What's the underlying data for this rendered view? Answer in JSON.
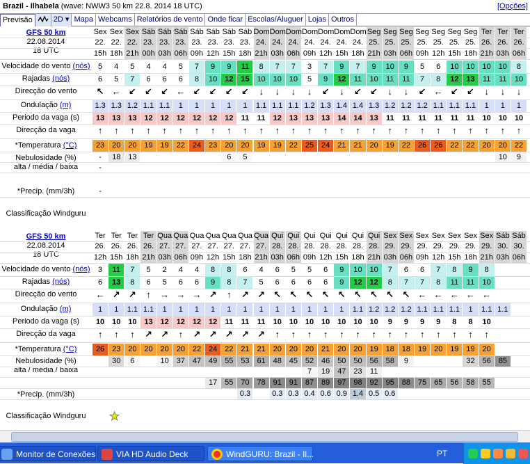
{
  "header": {
    "title": "Brazil - Ilhabela",
    "wave": "(wave: NWW3 50 km 22.8. 2014 18 UTC)",
    "options": "[Opções]"
  },
  "tabs": [
    {
      "label": "Previsão"
    },
    {
      "label": "2D"
    },
    {
      "label": "Mapa"
    },
    {
      "label": "Webcams"
    },
    {
      "label": "Relatórios de vento"
    },
    {
      "label": "Onde ficar"
    },
    {
      "label": "Escolas/Aluguer"
    },
    {
      "label": "Lojas"
    },
    {
      "label": "Outros"
    }
  ],
  "labels": {
    "wind": "Velocidade do vento",
    "wind_unit": "(nós)",
    "gust": "Rajadas",
    "gust_unit": "(nós)",
    "dir": "Direcção do vento",
    "wave": "Ondulação",
    "wave_unit": "(m)",
    "period": "Periodo da vaga (s)",
    "wdir": "Direcção da vaga",
    "temp": "*Temperatura",
    "temp_unit": "(°C)",
    "cloud1": "Nebulosidade (%)",
    "cloud2": "alta / média / baixa",
    "precip": "*Precip. (mm/3h)",
    "rating": "Classificação Windguru"
  },
  "block1": {
    "model": "GFS 50 km",
    "date": "22.08.2014",
    "utc": "18 UTC",
    "days": [
      "Sex",
      "Sex",
      "Sex",
      "Sáb",
      "Sáb",
      "Sáb",
      "Sáb",
      "Sáb",
      "Sáb",
      "Sáb",
      "Dom",
      "Dom",
      "Dom",
      "Dom",
      "Dom",
      "Dom",
      "Dom",
      "Seg",
      "Seg",
      "Seg",
      "Seg",
      "Seg",
      "Seg",
      "Seg",
      "Ter",
      "Ter",
      "Ter"
    ],
    "dates": [
      "22.",
      "22.",
      "22.",
      "23.",
      "23.",
      "23.",
      "23.",
      "23.",
      "23.",
      "23.",
      "24.",
      "24.",
      "24.",
      "24.",
      "24.",
      "24.",
      "24.",
      "25.",
      "25.",
      "25.",
      "25.",
      "25.",
      "25.",
      "25.",
      "26.",
      "26.",
      "26."
    ],
    "hours": [
      "15h",
      "18h",
      "21h",
      "00h",
      "03h",
      "06h",
      "09h",
      "12h",
      "15h",
      "18h",
      "21h",
      "03h",
      "06h",
      "09h",
      "12h",
      "15h",
      "18h",
      "21h",
      "03h",
      "06h",
      "09h",
      "12h",
      "15h",
      "18h",
      "21h",
      "03h",
      "06h"
    ],
    "wind": [
      "5",
      "4",
      "5",
      "4",
      "4",
      "5",
      "7",
      "9",
      "9",
      "11",
      "8",
      "7",
      "7",
      "3",
      "7",
      "9",
      "7",
      "9",
      "10",
      "9",
      "5",
      "6",
      "10",
      "10",
      "10",
      "10",
      "8"
    ],
    "gust": [
      "6",
      "5",
      "7",
      "6",
      "6",
      "6",
      "8",
      "10",
      "12",
      "15",
      "10",
      "10",
      "10",
      "5",
      "9",
      "12",
      "11",
      "10",
      "11",
      "11",
      "7",
      "8",
      "12",
      "13",
      "11",
      "11",
      "10"
    ],
    "dir": [
      "↖",
      "←",
      "↙",
      "↙",
      "↙",
      "←",
      "↙",
      "↙",
      "↙",
      "↙",
      "↓",
      "↓",
      "↓",
      "↓",
      "↙",
      "↓",
      "↙",
      "↙",
      "↓",
      "↓",
      "↙",
      "←",
      "↙",
      "↙",
      "↓",
      "↓",
      "↓"
    ],
    "wave": [
      "1.3",
      "1.3",
      "1.2",
      "1.1",
      "1.1",
      "1",
      "1",
      "1",
      "1",
      "1",
      "1.1",
      "1.1",
      "1.1",
      "1.2",
      "1.3",
      "1.4",
      "1.4",
      "1.3",
      "1.2",
      "1.2",
      "1.2",
      "1.1",
      "1.1",
      "1.1",
      "1",
      "1",
      "1"
    ],
    "period": [
      "13",
      "13",
      "13",
      "12",
      "12",
      "12",
      "12",
      "12",
      "12",
      "11",
      "11",
      "12",
      "13",
      "13",
      "13",
      "14",
      "14",
      "13",
      "11",
      "11",
      "11",
      "11",
      "11",
      "11",
      "10",
      "10",
      "10"
    ],
    "wdir": [
      "↑",
      "↑",
      "↑",
      "↑",
      "↑",
      "↑",
      "↑",
      "↑",
      "↑",
      "↑",
      "↑",
      "↑",
      "↑",
      "↑",
      "↑",
      "↑",
      "↑",
      "↑",
      "↑",
      "↑",
      "↑",
      "↑",
      "↑",
      "↑",
      "↑",
      "↑",
      "↑"
    ],
    "temp": [
      "23",
      "20",
      "20",
      "19",
      "19",
      "22",
      "24",
      "23",
      "20",
      "20",
      "19",
      "19",
      "22",
      "25",
      "24",
      "21",
      "21",
      "20",
      "19",
      "22",
      "26",
      "26",
      "22",
      "22",
      "20",
      "20",
      "22"
    ],
    "cloud_h": [
      "-",
      "18",
      "13",
      "",
      "",
      "",
      "",
      "",
      "6",
      "5",
      "",
      "",
      "",
      "",
      "",
      "",
      "",
      "",
      "",
      "",
      "",
      "",
      "",
      "",
      "",
      "10",
      "9"
    ],
    "cloud_m": [
      "-",
      "",
      "",
      "",
      "",
      "",
      "",
      "",
      "",
      "",
      "",
      "",
      "",
      "",
      "",
      "",
      "",
      "",
      "",
      "",
      "",
      "",
      "",
      "",
      "",
      "",
      ""
    ],
    "precip": [
      "-",
      "",
      "",
      "",
      "",
      "",
      "",
      "",
      "",
      "",
      "",
      "",
      "",
      "",
      "",
      "",
      "",
      "",
      "",
      "",
      "",
      "",
      "",
      "",
      "",
      "",
      ""
    ]
  },
  "block2": {
    "model": "GFS 50 km",
    "date": "22.08.2014",
    "utc": "18 UTC",
    "days": [
      "Ter",
      "Ter",
      "Ter",
      "Ter",
      "Qua",
      "Qua",
      "Qua",
      "Qua",
      "Qua",
      "Qua",
      "Qua",
      "Qui",
      "Qui",
      "Qui",
      "Qui",
      "Qui",
      "Qui",
      "Qui",
      "Sex",
      "Sex",
      "Sex",
      "Sex",
      "Sex",
      "Sex",
      "Sex",
      "Sáb",
      "Sáb"
    ],
    "dates": [
      "26.",
      "26.",
      "26.",
      "26.",
      "27.",
      "27.",
      "27.",
      "27.",
      "27.",
      "27.",
      "27.",
      "28.",
      "28.",
      "28.",
      "28.",
      "28.",
      "28.",
      "28.",
      "29.",
      "29.",
      "29.",
      "29.",
      "29.",
      "29.",
      "29.",
      "30.",
      "30."
    ],
    "hours": [
      "12h",
      "15h",
      "18h",
      "21h",
      "03h",
      "06h",
      "09h",
      "12h",
      "15h",
      "18h",
      "21h",
      "03h",
      "06h",
      "09h",
      "12h",
      "15h",
      "18h",
      "21h",
      "03h",
      "06h",
      "09h",
      "12h",
      "15h",
      "18h",
      "21h",
      "03h",
      "06h"
    ],
    "wind": [
      "3",
      "11",
      "7",
      "5",
      "2",
      "4",
      "4",
      "8",
      "8",
      "6",
      "4",
      "6",
      "5",
      "5",
      "6",
      "9",
      "10",
      "10",
      "7",
      "6",
      "6",
      "7",
      "8",
      "9",
      "8",
      "",
      ""
    ],
    "gust": [
      "6",
      "13",
      "8",
      "6",
      "5",
      "6",
      "6",
      "9",
      "8",
      "7",
      "5",
      "6",
      "6",
      "6",
      "6",
      "9",
      "12",
      "12",
      "8",
      "7",
      "7",
      "8",
      "11",
      "11",
      "10",
      "",
      ""
    ],
    "dir": [
      "←",
      "↗",
      "↗",
      "↑",
      "→",
      "→",
      "→",
      "↗",
      "↑",
      "↗",
      "↗",
      "↖",
      "↖",
      "↖",
      "↖",
      "↖",
      "↖",
      "↖",
      "↖",
      "↖",
      "←",
      "←",
      "←",
      "←",
      "←",
      "",
      ""
    ],
    "wave": [
      "1",
      "1",
      "1.1",
      "1.1",
      "1",
      "1",
      "1",
      "1",
      "1",
      "1",
      "1",
      "1",
      "1",
      "1",
      "1",
      "1",
      "1.1",
      "1.2",
      "1.2",
      "1.2",
      "1.1",
      "1.1",
      "1.1",
      "1",
      "1.1",
      "1.1",
      ""
    ],
    "period": [
      "10",
      "10",
      "10",
      "13",
      "12",
      "12",
      "12",
      "12",
      "11",
      "11",
      "11",
      "10",
      "10",
      "10",
      "10",
      "10",
      "10",
      "10",
      "9",
      "9",
      "9",
      "9",
      "8",
      "8",
      "10",
      "",
      ""
    ],
    "wdir": [
      "↑",
      "↑",
      "↑",
      "↗",
      "↗",
      "↑",
      "↗",
      "↗",
      "↗",
      "↗",
      "↗",
      "↑",
      "↑",
      "↑",
      "↑",
      "↑",
      "↑",
      "↑",
      "↑",
      "↑",
      "↑",
      "↑",
      "↑",
      "↑",
      "↑",
      "",
      ""
    ],
    "temp": [
      "26",
      "23",
      "20",
      "20",
      "20",
      "20",
      "22",
      "24",
      "22",
      "21",
      "21",
      "20",
      "20",
      "20",
      "21",
      "20",
      "20",
      "19",
      "18",
      "18",
      "19",
      "20",
      "19",
      "19",
      "20",
      "",
      ""
    ],
    "cloud_h": [
      "",
      "30",
      "6",
      "",
      "10",
      "37",
      "47",
      "49",
      "55",
      "53",
      "61",
      "48",
      "45",
      "52",
      "46",
      "50",
      "50",
      "56",
      "58",
      "9",
      "",
      "",
      "",
      "32",
      "56",
      "85",
      ""
    ],
    "cloud_m": [
      "",
      "",
      "",
      "",
      "",
      "",
      "",
      "",
      "",
      "",
      "",
      "",
      "",
      "7",
      "19",
      "47",
      "23",
      "11",
      "",
      "",
      "",
      "",
      "",
      "",
      "",
      "",
      ""
    ],
    "cloud_l": [
      "",
      "",
      "",
      "",
      "",
      "",
      "",
      "17",
      "55",
      "70",
      "78",
      "91",
      "91",
      "87",
      "89",
      "97",
      "98",
      "92",
      "95",
      "88",
      "75",
      "65",
      "56",
      "58",
      "55",
      "",
      ""
    ],
    "precip": [
      "",
      "",
      "",
      "",
      "",
      "",
      "",
      "",
      "",
      "0.3",
      "",
      "0.3",
      "0.3",
      "0.4",
      "0.6",
      "0.9",
      "1.4",
      "0.5",
      "0.6",
      "",
      "",
      "",
      "",
      "",
      "",
      "",
      ""
    ],
    "rating_star": "★"
  },
  "taskbar": {
    "items": [
      {
        "label": "Monitor de Conexões"
      },
      {
        "label": "VIA HD Audio Deck"
      },
      {
        "label": "WindGURU: Brazil - Il..."
      }
    ],
    "lang": "PT"
  },
  "colors": {
    "temp_hot": "#e85d1f",
    "temp_warm": "#f4a236",
    "wind_lo": "#ffffff",
    "wind_mid": "#c6f0f0",
    "wind_hi": "#66e0c0",
    "wind_top": "#22cc44",
    "period": "#f7c9c9",
    "wave": "#d7def7"
  }
}
